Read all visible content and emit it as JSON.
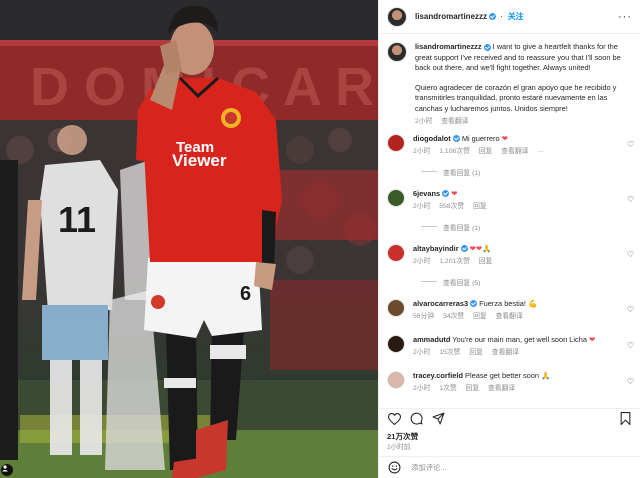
{
  "photo": {
    "alt_icon": "user-icon",
    "sponsor_line1": "Team",
    "sponsor_line2": "Viewer",
    "jersey_number_back": "11",
    "shorts_number": "6"
  },
  "post": {
    "username": "lisandromartinezzz",
    "follow_label": "关注",
    "more_label": "···",
    "caption_en": "I want to give a heartfelt thanks for the great support I've received and to reassure you that I'll soon be back out there, and we'll fight together. Always united!",
    "caption_es": "Quiero agradecer de corazón el gran apoyo que he recibido y transmitirles tranquilidad, pronto estaré nuevamente en las canchas y lucharemos juntos. Unidos siempre!",
    "caption_time": "2小时",
    "caption_translate": "查看翻译"
  },
  "comments": [
    {
      "user": "diogodalot",
      "text": "Mi guerrero",
      "emoji": "❤",
      "time": "2小时",
      "likes": "1,106次赞",
      "reply": "回复",
      "translate": "查看翻译",
      "more": "···",
      "replies": "查看回复 (1)",
      "avatar_color": "#b3241f"
    },
    {
      "user": "6jevans",
      "text": "",
      "emoji": "❤",
      "time": "2小时",
      "likes": "558次赞",
      "reply": "回复",
      "translate": "",
      "replies": "查看回复 (1)",
      "avatar_color": "#3a5a28"
    },
    {
      "user": "altaybayindir",
      "text": "",
      "emoji": "❤❤🙏",
      "time": "2小时",
      "likes": "1,201次赞",
      "reply": "回复",
      "translate": "",
      "replies": "查看回复 (5)",
      "avatar_color": "#c9302c"
    },
    {
      "user": "alvarocarreras3",
      "text": "Fuerza bestia!",
      "emoji": "💪",
      "time": "56分钟",
      "likes": "34次赞",
      "reply": "回复",
      "translate": "查看翻译",
      "replies": "",
      "avatar_color": "#6b4a2f"
    },
    {
      "user": "ammadutd",
      "text": "You're our main man, get well soon Licha",
      "emoji": "❤",
      "time": "2小时",
      "likes": "15次赞",
      "reply": "回复",
      "translate": "查看翻译",
      "replies": "",
      "avatar_color": "#2a1b12"
    },
    {
      "user": "tracey.corfield",
      "text": "Please get better soon",
      "emoji": "🙏",
      "time": "2小时",
      "likes": "1次赞",
      "reply": "回复",
      "translate": "查看翻译",
      "replies": "",
      "avatar_color": "#d9b8a8"
    }
  ],
  "footer": {
    "likes_count": "21万次赞",
    "post_time": "2小时前",
    "comment_placeholder": "添加评论..."
  },
  "colors": {
    "accent_blue": "#0095f6",
    "verified_blue": "#3897f0",
    "heart_red": "#ed4956",
    "muted_text": "#8e8e8e"
  }
}
